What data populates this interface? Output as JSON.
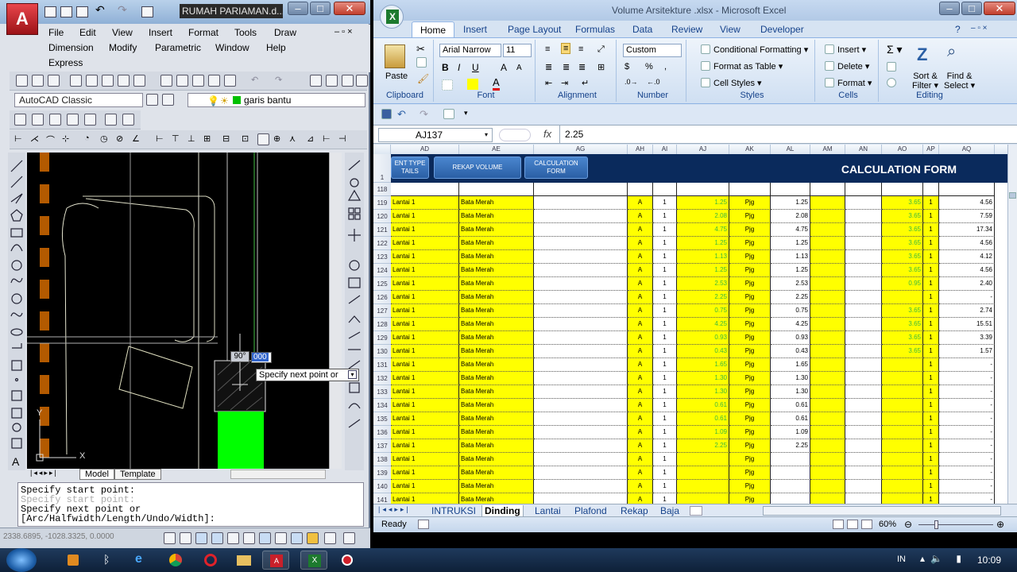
{
  "autocad": {
    "title": "RUMAH PARIAMAN.d...",
    "menu_row1": [
      "File",
      "Edit",
      "View",
      "Insert",
      "Format",
      "Tools",
      "Draw"
    ],
    "menu_row2": [
      "Dimension",
      "Modify",
      "Parametric",
      "Window",
      "Help"
    ],
    "menu_row3": [
      "Express"
    ],
    "workspace": "AutoCAD Classic",
    "layer": "garis bantu",
    "tabs": [
      "Model",
      "Template"
    ],
    "cmd_lines": [
      "Specify start point:",
      "Specify next point or",
      "[Arc/Halfwidth/Length/Undo/Width]:"
    ],
    "tooltip": "Specify next point or",
    "angle": "90°",
    "length": "000",
    "coords": "2338.6895, -1028.3325, 0.0000",
    "ucs_x": "X",
    "ucs_y": "Y"
  },
  "excel": {
    "title": "Volume Arsitekture .xlsx - Microsoft Excel",
    "ribbon_tabs": [
      "Home",
      "Insert",
      "Page Layout",
      "Formulas",
      "Data",
      "Review",
      "View",
      "Developer"
    ],
    "font_name": "Arial Narrow",
    "font_size": "11",
    "number_format": "Custom",
    "buttons": {
      "paste": "Paste",
      "cond_format": "Conditional Formatting",
      "format_table": "Format as Table",
      "cell_styles": "Cell Styles",
      "insert": "Insert",
      "delete": "Delete",
      "format": "Format",
      "sort": "Sort &",
      "sort2": "Filter",
      "find": "Find &",
      "find2": "Select"
    },
    "groups": [
      "Clipboard",
      "Font",
      "Alignment",
      "Number",
      "Styles",
      "Cells",
      "Editing"
    ],
    "name_box": "AJ137",
    "formula": "2.25",
    "columns": [
      "AD",
      "AE",
      "AG",
      "AH",
      "AI",
      "AJ",
      "AK",
      "AL",
      "AM",
      "AN",
      "AO",
      "AP",
      "AQ"
    ],
    "banner_buttons": [
      "ENT TYPE TAILS",
      "REKAP VOLUME",
      "CALCULATION FORM"
    ],
    "banner_title": "CALCULATION FORM",
    "first_rows": [
      "1",
      "118"
    ],
    "rows": [
      {
        "n": "119",
        "a": "Lantai 1",
        "b": "Bata Merah",
        "c": "A",
        "d": "1",
        "e": "1.25",
        "f": "Pjg",
        "g": "1.25",
        "h": "3.65",
        "i": "1",
        "j": "4.56"
      },
      {
        "n": "120",
        "a": "Lantai 1",
        "b": "Bata Merah",
        "c": "A",
        "d": "1",
        "e": "2.08",
        "f": "Pjg",
        "g": "2.08",
        "h": "3.65",
        "i": "1",
        "j": "7.59"
      },
      {
        "n": "121",
        "a": "Lantai 1",
        "b": "Bata Merah",
        "c": "A",
        "d": "1",
        "e": "4.75",
        "f": "Pjg",
        "g": "4.75",
        "h": "3.65",
        "i": "1",
        "j": "17.34"
      },
      {
        "n": "122",
        "a": "Lantai 1",
        "b": "Bata Merah",
        "c": "A",
        "d": "1",
        "e": "1.25",
        "f": "Pjg",
        "g": "1.25",
        "h": "3.65",
        "i": "1",
        "j": "4.56"
      },
      {
        "n": "123",
        "a": "Lantai 1",
        "b": "Bata Merah",
        "c": "A",
        "d": "1",
        "e": "1.13",
        "f": "Pjg",
        "g": "1.13",
        "h": "3.65",
        "i": "1",
        "j": "4.12"
      },
      {
        "n": "124",
        "a": "Lantai 1",
        "b": "Bata Merah",
        "c": "A",
        "d": "1",
        "e": "1.25",
        "f": "Pjg",
        "g": "1.25",
        "h": "3.65",
        "i": "1",
        "j": "4.56"
      },
      {
        "n": "125",
        "a": "Lantai 1",
        "b": "Bata Merah",
        "c": "A",
        "d": "1",
        "e": "2.53",
        "f": "Pjg",
        "g": "2.53",
        "h": "0.95",
        "i": "1",
        "j": "2.40"
      },
      {
        "n": "126",
        "a": "Lantai 1",
        "b": "Bata Merah",
        "c": "A",
        "d": "1",
        "e": "2.25",
        "f": "Pjg",
        "g": "2.25",
        "h": "",
        "i": "1",
        "j": "-"
      },
      {
        "n": "127",
        "a": "Lantai 1",
        "b": "Bata Merah",
        "c": "A",
        "d": "1",
        "e": "0.75",
        "f": "Pjg",
        "g": "0.75",
        "h": "3.65",
        "i": "1",
        "j": "2.74"
      },
      {
        "n": "128",
        "a": "Lantai 1",
        "b": "Bata Merah",
        "c": "A",
        "d": "1",
        "e": "4.25",
        "f": "Pjg",
        "g": "4.25",
        "h": "3.65",
        "i": "1",
        "j": "15.51"
      },
      {
        "n": "129",
        "a": "Lantai 1",
        "b": "Bata Merah",
        "c": "A",
        "d": "1",
        "e": "0.93",
        "f": "Pjg",
        "g": "0.93",
        "h": "3.65",
        "i": "1",
        "j": "3.39"
      },
      {
        "n": "130",
        "a": "Lantai 1",
        "b": "Bata Merah",
        "c": "A",
        "d": "1",
        "e": "0.43",
        "f": "Pjg",
        "g": "0.43",
        "h": "3.65",
        "i": "1",
        "j": "1.57"
      },
      {
        "n": "131",
        "a": "Lantai 1",
        "b": "Bata Merah",
        "c": "A",
        "d": "1",
        "e": "1.65",
        "f": "Pjg",
        "g": "1.65",
        "h": "",
        "i": "1",
        "j": "-"
      },
      {
        "n": "132",
        "a": "Lantai 1",
        "b": "Bata Merah",
        "c": "A",
        "d": "1",
        "e": "1.30",
        "f": "Pjg",
        "g": "1.30",
        "h": "",
        "i": "1",
        "j": "-"
      },
      {
        "n": "133",
        "a": "Lantai 1",
        "b": "Bata Merah",
        "c": "A",
        "d": "1",
        "e": "1.30",
        "f": "Pjg",
        "g": "1.30",
        "h": "",
        "i": "1",
        "j": "-"
      },
      {
        "n": "134",
        "a": "Lantai 1",
        "b": "Bata Merah",
        "c": "A",
        "d": "1",
        "e": "0.61",
        "f": "Pjg",
        "g": "0.61",
        "h": "",
        "i": "1",
        "j": "-"
      },
      {
        "n": "135",
        "a": "Lantai 1",
        "b": "Bata Merah",
        "c": "A",
        "d": "1",
        "e": "0.61",
        "f": "Pjg",
        "g": "0.61",
        "h": "",
        "i": "1",
        "j": "-"
      },
      {
        "n": "136",
        "a": "Lantai 1",
        "b": "Bata Merah",
        "c": "A",
        "d": "1",
        "e": "1.09",
        "f": "Pjg",
        "g": "1.09",
        "h": "",
        "i": "1",
        "j": "-"
      },
      {
        "n": "137",
        "a": "Lantai 1",
        "b": "Bata Merah",
        "c": "A",
        "d": "1",
        "e": "2.25",
        "f": "Pjg",
        "g": "2.25",
        "h": "",
        "i": "1",
        "j": "-"
      },
      {
        "n": "138",
        "a": "Lantai 1",
        "b": "Bata Merah",
        "c": "A",
        "d": "1",
        "e": "",
        "f": "Pjg",
        "g": "",
        "h": "",
        "i": "1",
        "j": "-"
      },
      {
        "n": "139",
        "a": "Lantai 1",
        "b": "Bata Merah",
        "c": "A",
        "d": "1",
        "e": "",
        "f": "Pjg",
        "g": "",
        "h": "",
        "i": "1",
        "j": "-"
      },
      {
        "n": "140",
        "a": "Lantai 1",
        "b": "Bata Merah",
        "c": "A",
        "d": "1",
        "e": "",
        "f": "Pjg",
        "g": "",
        "h": "",
        "i": "1",
        "j": "-"
      },
      {
        "n": "141",
        "a": "Lantai 1",
        "b": "Bata Merah",
        "c": "A",
        "d": "1",
        "e": "",
        "f": "Pjg",
        "g": "",
        "h": "",
        "i": "1",
        "j": "-"
      }
    ],
    "sheet_tabs": [
      "INTRUKSI",
      "Dinding",
      "Lantai",
      "Plafond",
      "Rekap",
      "Baja"
    ],
    "active_sheet": "Dinding",
    "status": "Ready",
    "zoom": "60%"
  },
  "taskbar": {
    "lang": "IN",
    "time": "10:09"
  },
  "colors": {
    "cell_yellow": "#ffff00",
    "banner": "#0a2a5c",
    "green_text": "#3cba3c"
  }
}
